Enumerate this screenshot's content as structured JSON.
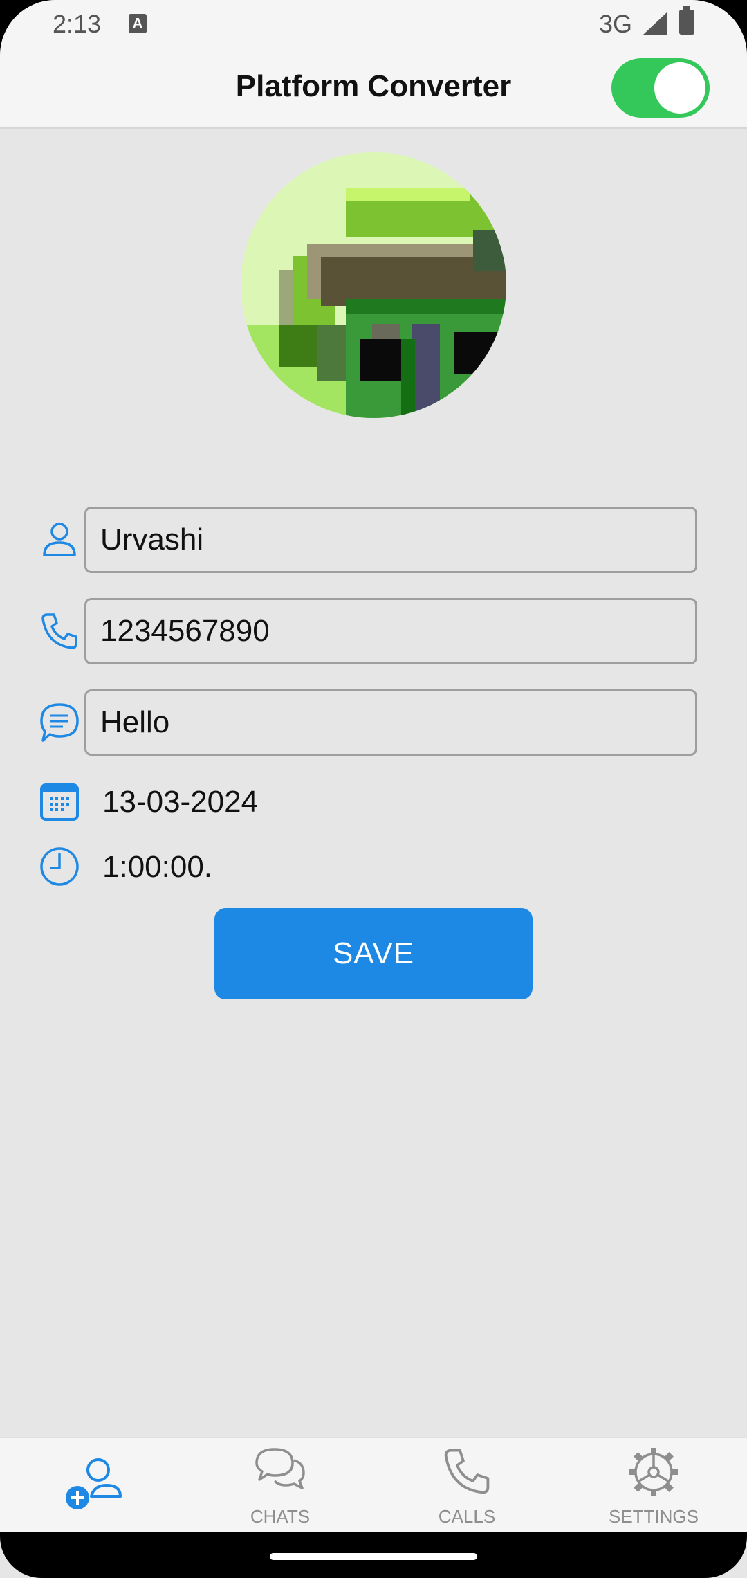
{
  "status_bar": {
    "time": "2:13",
    "notification_icon": "a-icon",
    "network": "3G",
    "signal_icon": "signal-icon",
    "battery_icon": "battery-icon"
  },
  "app_bar": {
    "title": "Platform Converter",
    "toggle_on": true,
    "toggle_color": "#34c759"
  },
  "avatar": {
    "icon": "profile-photo"
  },
  "form": {
    "name": {
      "icon": "person-icon",
      "value": "Urvashi"
    },
    "phone": {
      "icon": "phone-icon",
      "value": "1234567890"
    },
    "message": {
      "icon": "chat-bubble-icon",
      "value": "Hello"
    },
    "date": {
      "icon": "calendar-icon",
      "value": "13-03-2024"
    },
    "time": {
      "icon": "clock-icon",
      "value": "1:00:00."
    }
  },
  "save_button": {
    "label": "SAVE",
    "color": "#1e88e5"
  },
  "bottom_nav": {
    "items": [
      {
        "icon": "add-contact-icon",
        "label": "",
        "active": true
      },
      {
        "icon": "chats-icon",
        "label": "CHATS",
        "active": false
      },
      {
        "icon": "phone-icon",
        "label": "CALLS",
        "active": false
      },
      {
        "icon": "gear-icon",
        "label": "SETTINGS",
        "active": false
      }
    ]
  },
  "colors": {
    "accent": "#1e88e5",
    "background": "#e6e6e6"
  }
}
